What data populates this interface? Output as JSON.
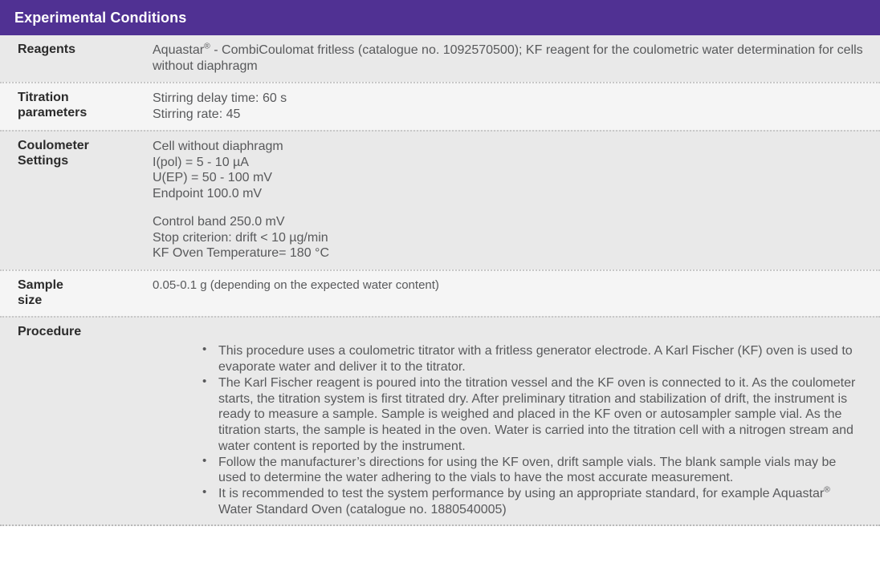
{
  "header": {
    "title": "Experimental Conditions",
    "background_color": "#503193",
    "text_color": "#ffffff"
  },
  "rows": [
    {
      "label": "Reagents",
      "lines": [
        "Aquastar® - CombiCoulomat fritless (catalogue no. 1092570500); KF reagent for the coulometric water determination for cells without diaphragm"
      ]
    },
    {
      "label": "Titration parameters",
      "lines": [
        "Stirring delay time: 60 s",
        "Stirring rate: 45"
      ]
    },
    {
      "label": "Coulometer Settings",
      "lines": [
        "Cell without diaphragm",
        "I(pol) = 5 - 10 µA",
        "U(EP) = 50 - 100 mV",
        "Endpoint 100.0 mV",
        "Control band 250.0 mV",
        "Stop criterion: drift < 10 µg/min",
        "KF Oven Temperature= 180 °C"
      ]
    },
    {
      "label": "Sample size",
      "lines": [
        "0.05-0.1 g (depending on the expected water content)"
      ]
    }
  ],
  "reagents": {
    "label": "Reagents",
    "text_before_sup": "Aquastar",
    "sup": "®",
    "text_after_sup": " - CombiCoulomat fritless (catalogue no. 1092570500); KF reagent for the coulometric water determination for cells without diaphragm"
  },
  "titration": {
    "label_line1": "Titration",
    "label_line2": "parameters",
    "line1": "Stirring delay time: 60 s",
    "line2": "Stirring rate: 45"
  },
  "coulometer": {
    "label_line1": "Coulometer",
    "label_line2": "Settings",
    "line1": "Cell without diaphragm",
    "line2": "I(pol) = 5 - 10 µA",
    "line3": "U(EP) = 50 - 100 mV",
    "line4": "Endpoint 100.0 mV",
    "line5": "Control band 250.0 mV",
    "line6": "Stop criterion: drift < 10 µg/min",
    "line7": "KF Oven Temperature= 180 °C"
  },
  "sample_size": {
    "label_line1": "Sample",
    "label_line2": "size",
    "value": "0.05-0.1 g (depending on the expected water content)"
  },
  "procedure": {
    "label": "Procedure",
    "bullets": [
      "This procedure uses a coulometric titrator with a fritless generator electrode. A Karl Fischer (KF) oven is used to evaporate water and deliver it to the titrator.",
      "The Karl Fischer reagent is poured into the titration vessel and the KF oven is connected to it. As the coulometer starts, the titration system is first titrated dry. After preliminary titration and stabilization of drift, the instrument is ready to measure a sample. Sample is weighed and placed in the KF oven or autosampler sample vial. As the titration starts, the sample is heated in the oven. Water is carried into the titration cell with a nitrogen stream and water content is reported by the instrument.",
      "Follow the manufacturer’s directions for using the KF oven, drift sample vials. The blank sample vials may be used to determine the water adhering to the vials to have the most accurate measurement."
    ],
    "bullet_last": {
      "text_before_sup": "It is recommended to test the system performance by using an appropriate standard, for example Aquastar",
      "sup": "®",
      "text_after_sup": " Water Standard Oven (catalogue no. 1880540005)"
    }
  },
  "colors": {
    "header_purple": "#503193",
    "row_gray": "#e9e9e9",
    "row_light": "#f5f5f5",
    "label_text": "#2b2b2b",
    "body_text": "#58595b"
  }
}
